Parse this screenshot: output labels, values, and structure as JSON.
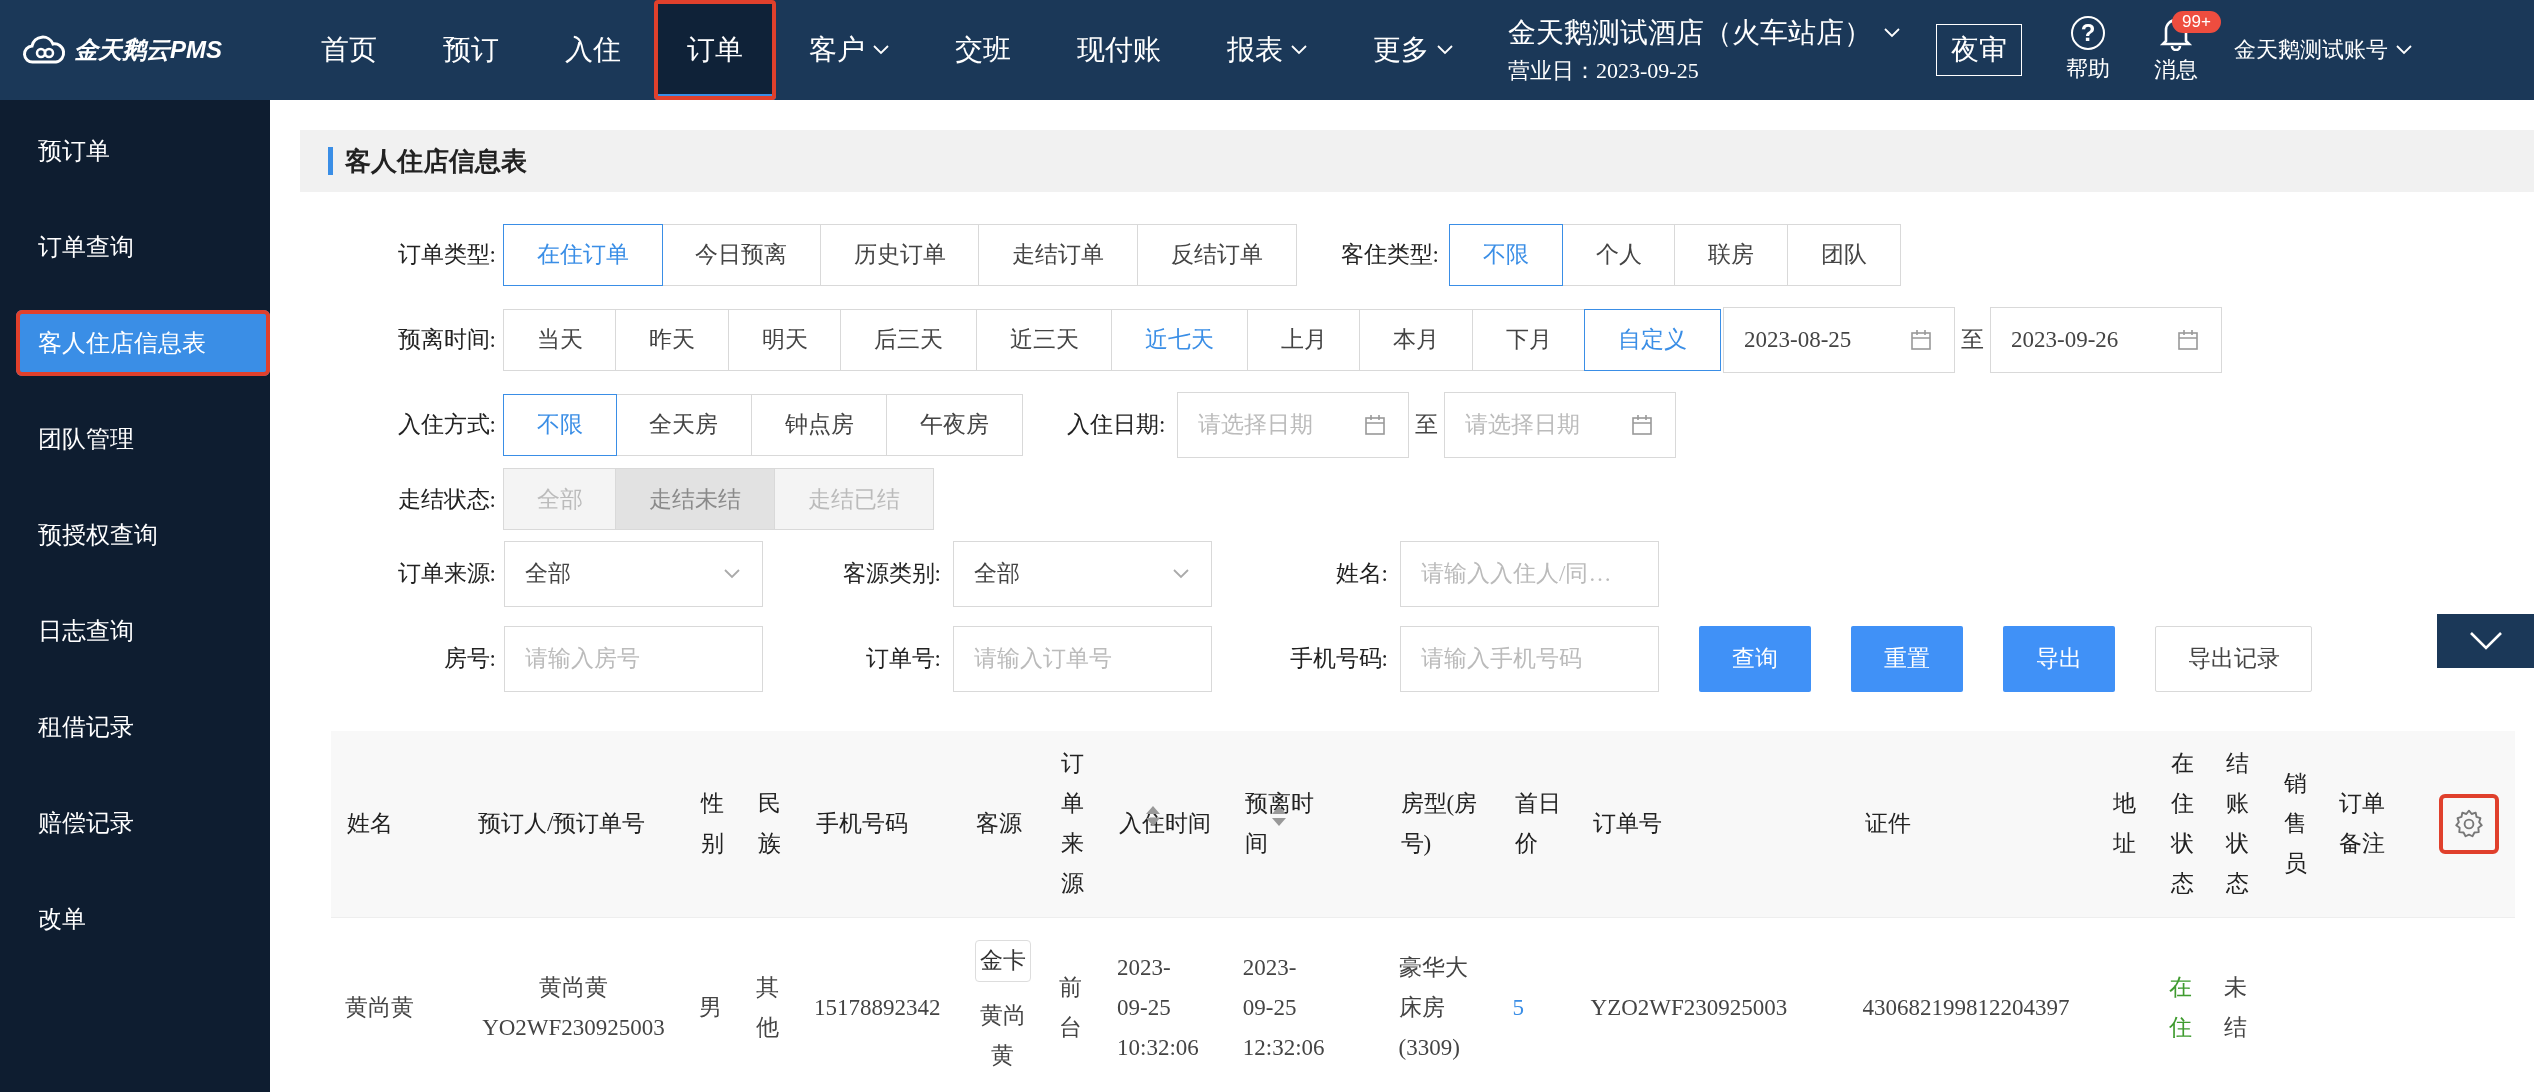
{
  "brand": {
    "name": "金天鹅云PMS"
  },
  "nav": [
    {
      "label": "首页",
      "dropdown": false,
      "selected": false,
      "annotated": false
    },
    {
      "label": "预订",
      "dropdown": false,
      "selected": false,
      "annotated": false
    },
    {
      "label": "入住",
      "dropdown": false,
      "selected": false,
      "annotated": false
    },
    {
      "label": "订单",
      "dropdown": false,
      "selected": true,
      "annotated": true
    },
    {
      "label": "客户",
      "dropdown": true,
      "selected": false,
      "annotated": false
    },
    {
      "label": "交班",
      "dropdown": false,
      "selected": false,
      "annotated": false
    },
    {
      "label": "现付账",
      "dropdown": false,
      "selected": false,
      "annotated": false
    },
    {
      "label": "报表",
      "dropdown": true,
      "selected": false,
      "annotated": false
    },
    {
      "label": "更多",
      "dropdown": true,
      "selected": false,
      "annotated": false
    }
  ],
  "hotel": {
    "name": "金天鹅测试酒店（火车站店）",
    "business_date": "营业日：2023-09-25"
  },
  "night_audit_button": "夜审",
  "help": {
    "icon": "?",
    "label": "帮助"
  },
  "messages": {
    "badge": "99+",
    "label": "消息"
  },
  "account": "金天鹅测试账号",
  "sidebar": {
    "items": [
      {
        "label": "预订单",
        "selected": false,
        "annotated": false
      },
      {
        "label": "订单查询",
        "selected": false,
        "annotated": false
      },
      {
        "label": "客人住店信息表",
        "selected": true,
        "annotated": true
      },
      {
        "label": "团队管理",
        "selected": false,
        "annotated": false
      },
      {
        "label": "预授权查询",
        "selected": false,
        "annotated": false
      },
      {
        "label": "日志查询",
        "selected": false,
        "annotated": false
      },
      {
        "label": "租借记录",
        "selected": false,
        "annotated": false
      },
      {
        "label": "赔偿记录",
        "selected": false,
        "annotated": false
      },
      {
        "label": "改单",
        "selected": false,
        "annotated": false
      }
    ]
  },
  "page_title": "客人住店信息表",
  "filters": {
    "rows": [
      {
        "fields": [
          {
            "kind": "segmented",
            "label": "订单类型:",
            "disabled": false,
            "options": [
              {
                "label": "在住订单",
                "selected": true,
                "accent": false
              },
              {
                "label": "今日预离",
                "selected": false,
                "accent": false
              },
              {
                "label": "历史订单",
                "selected": false,
                "accent": false
              },
              {
                "label": "走结订单",
                "selected": false,
                "accent": false
              },
              {
                "label": "反结订单",
                "selected": false,
                "accent": false
              }
            ]
          },
          {
            "kind": "segmented",
            "label": "客住类型:",
            "disabled": false,
            "options": [
              {
                "label": "不限",
                "selected": true,
                "accent": false
              },
              {
                "label": "个人",
                "selected": false,
                "accent": false
              },
              {
                "label": "联房",
                "selected": false,
                "accent": false
              },
              {
                "label": "团队",
                "selected": false,
                "accent": false
              }
            ]
          }
        ]
      },
      {
        "fields": [
          {
            "kind": "segmented",
            "label": "预离时间:",
            "disabled": false,
            "options": [
              {
                "label": "当天",
                "selected": false,
                "accent": false
              },
              {
                "label": "昨天",
                "selected": false,
                "accent": false
              },
              {
                "label": "明天",
                "selected": false,
                "accent": false
              },
              {
                "label": "后三天",
                "selected": false,
                "accent": false
              },
              {
                "label": "近三天",
                "selected": false,
                "accent": false
              },
              {
                "label": "近七天",
                "selected": false,
                "accent": true
              },
              {
                "label": "上月",
                "selected": false,
                "accent": false
              },
              {
                "label": "本月",
                "selected": false,
                "accent": false
              },
              {
                "label": "下月",
                "selected": false,
                "accent": false
              },
              {
                "label": "自定义",
                "selected": true,
                "accent": false
              }
            ]
          },
          {
            "kind": "daterange",
            "from": {
              "value": "2023-08-25"
            },
            "separator": "至",
            "to": {
              "value": "2023-09-26"
            }
          }
        ]
      },
      {
        "fields": [
          {
            "kind": "segmented",
            "label": "入住方式:",
            "disabled": false,
            "options": [
              {
                "label": "不限",
                "selected": true,
                "accent": false
              },
              {
                "label": "全天房",
                "selected": false,
                "accent": false
              },
              {
                "label": "钟点房",
                "selected": false,
                "accent": false
              },
              {
                "label": "午夜房",
                "selected": false,
                "accent": false
              }
            ]
          },
          {
            "kind": "daterange",
            "label": "入住日期:",
            "from": {
              "placeholder": "请选择日期"
            },
            "separator": "至",
            "to": {
              "placeholder": "请选择日期"
            }
          }
        ]
      },
      {
        "fields": [
          {
            "kind": "segmented",
            "label": "走结状态:",
            "disabled": true,
            "options": [
              {
                "label": "全部",
                "selected": false
              },
              {
                "label": "走结未结",
                "selected": true
              },
              {
                "label": "走结已结",
                "selected": false
              }
            ]
          }
        ]
      },
      {
        "fields": [
          {
            "kind": "select",
            "label": "订单来源:",
            "value": "全部"
          },
          {
            "kind": "select",
            "label": "客源类别:",
            "value": "全部"
          },
          {
            "kind": "input",
            "label": "姓名:",
            "placeholder": "请输入入住人/同…"
          }
        ]
      },
      {
        "fields": [
          {
            "kind": "input",
            "label": "房号:",
            "placeholder": "请输入房号"
          },
          {
            "kind": "input",
            "label": "订单号:",
            "placeholder": "请输入订单号"
          },
          {
            "kind": "input",
            "label": "手机号码:",
            "placeholder": "请输入手机号码"
          },
          {
            "kind": "button",
            "label": "查询",
            "primary": true
          },
          {
            "kind": "button",
            "label": "重置",
            "primary": true
          },
          {
            "kind": "button",
            "label": "导出",
            "primary": true
          },
          {
            "kind": "button",
            "label": "导出记录",
            "primary": false
          }
        ]
      }
    ]
  },
  "table": {
    "settings_annotated": true,
    "columns": [
      {
        "label": "姓名",
        "sortable": false
      },
      {
        "label": "预订人/预订单号",
        "sortable": false
      },
      {
        "label": "性别",
        "sortable": false
      },
      {
        "label": "民族",
        "sortable": false
      },
      {
        "label": "手机号码",
        "sortable": false
      },
      {
        "label": "客源",
        "sortable": false
      },
      {
        "label": "订单来源",
        "sortable": false
      },
      {
        "label": "入住时间",
        "sortable": true
      },
      {
        "label": "预离时间",
        "sortable": true
      },
      {
        "label": "房型(房号)",
        "sortable": false
      },
      {
        "label": "首日价",
        "sortable": false
      },
      {
        "label": "订单号",
        "sortable": false
      },
      {
        "label": "证件",
        "sortable": false
      },
      {
        "label": "地址",
        "sortable": false
      },
      {
        "label": "在住状态",
        "sortable": false
      },
      {
        "label": "结账状态",
        "sortable": false
      },
      {
        "label": "销售员",
        "sortable": false
      },
      {
        "label": "订单备注",
        "sortable": false
      }
    ],
    "rows": [
      {
        "cells": [
          {
            "kind": "text",
            "text": "黄尚黄"
          },
          {
            "kind": "stack",
            "lines": [
              "黄尚黄",
              "YO2WF230925003"
            ]
          },
          {
            "kind": "text",
            "text": "男"
          },
          {
            "kind": "text",
            "text": "其他"
          },
          {
            "kind": "text",
            "text": "15178892342"
          },
          {
            "kind": "tagged",
            "tag": "金卡",
            "text": "黄尚黄"
          },
          {
            "kind": "text",
            "text": "前台"
          },
          {
            "kind": "text",
            "text": "2023-09-25 10:32:06"
          },
          {
            "kind": "text",
            "text": "2023-09-25 12:32:06"
          },
          {
            "kind": "text",
            "text": "豪华大床房(3309)"
          },
          {
            "kind": "link",
            "text": "5"
          },
          {
            "kind": "text",
            "text": "YZO2WF230925003"
          },
          {
            "kind": "text",
            "text": "430682199812204397"
          },
          {
            "kind": "empty"
          },
          {
            "kind": "status",
            "text": "在住"
          },
          {
            "kind": "text",
            "text": "未结"
          },
          {
            "kind": "empty"
          },
          {
            "kind": "empty"
          }
        ]
      }
    ]
  }
}
